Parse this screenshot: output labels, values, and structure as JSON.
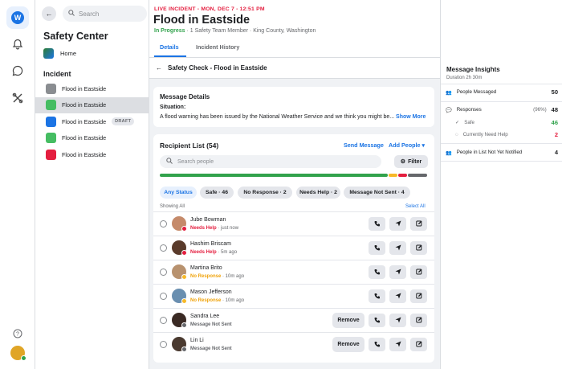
{
  "rail": {
    "logo": "workplace-logo",
    "icons": [
      "bell-icon",
      "chat-icon",
      "tools-icon",
      "help-icon",
      "avatar"
    ]
  },
  "sidebar": {
    "search_placeholder": "Search",
    "title": "Safety Center",
    "home_label": "Home",
    "section": "Incident",
    "items": [
      {
        "label": "Flood in Eastside",
        "color": "#8a8d91",
        "badge": ""
      },
      {
        "label": "Flood in Eastside",
        "color": "#45bd62",
        "badge": ""
      },
      {
        "label": "Flood in Eastside",
        "color": "#1b74e4",
        "badge": "DRAFT"
      },
      {
        "label": "Flood in Eastside",
        "color": "#45bd62",
        "badge": ""
      },
      {
        "label": "Flood in Eastside",
        "color": "#e41e3f",
        "badge": ""
      }
    ]
  },
  "header": {
    "live": "LIVE INCIDENT - MON, DEC 7 - 12:51 PM",
    "title": "Flood in Eastside",
    "status": "In Progress",
    "details": " · 1 Safety Team Member · King County, Washington",
    "tabs": [
      "Details",
      "Incident History"
    ]
  },
  "safety_check": {
    "title": "Safety Check - Flood in Eastside"
  },
  "message": {
    "title": "Message Details",
    "situation_label": "Situation:",
    "text": "A flood warning has been issued by the National Weather Service and we think you might be... ",
    "show_more": "Show More"
  },
  "recipients": {
    "title": "Recipient List (54)",
    "send": "Send Message",
    "add": "Add People",
    "search_placeholder": "Search people",
    "filter": "Filter",
    "progress": {
      "safe": 46,
      "no_response": 2,
      "needs_help": 2,
      "not_sent": 4,
      "colors": [
        "#31a24c",
        "#f7b928",
        "#e41e3f",
        "#65676b"
      ]
    },
    "chips": [
      "Any Status",
      "Safe · 46",
      "No Response · 2",
      "Needs Help · 2",
      "Message Not Sent · 4"
    ],
    "showing": "Showing All",
    "select_all": "Select All",
    "remove": "Remove",
    "rows": [
      {
        "name": "Jube Bowman",
        "status": "Needs Help",
        "time": " · just now",
        "status_color": "#e41e3f",
        "avatar": "#c58a6a",
        "dot": "#e41e3f"
      },
      {
        "name": "Hashim Briscam",
        "status": "Needs Help",
        "time": " · 5m ago",
        "status_color": "#e41e3f",
        "avatar": "#5a3b2b",
        "dot": "#e41e3f"
      },
      {
        "name": "Martina Brito",
        "status": "No Response",
        "time": " · 10m ago",
        "status_color": "#f0a30a",
        "avatar": "#b8926f",
        "dot": "#f7b928"
      },
      {
        "name": "Mason Jefferson",
        "status": "No Response",
        "time": " · 10m ago",
        "status_color": "#f0a30a",
        "avatar": "#6a8fb0",
        "dot": "#f7b928"
      },
      {
        "name": "Sandra Lee",
        "status": "Message Not Sent",
        "time": "",
        "status_color": "#65676b",
        "avatar": "#3a2a24",
        "dot": "#65676b"
      },
      {
        "name": "Lin Li",
        "status": "Message Not Sent",
        "time": "",
        "status_color": "#65676b",
        "avatar": "#4a3a30",
        "dot": "#65676b"
      }
    ]
  },
  "insights": {
    "title": "Message Insights",
    "duration": "Duration 2h 30m",
    "people_messaged": "People Messaged",
    "people_messaged_v": "50",
    "responses": "Responses",
    "responses_pct": "(96%)",
    "responses_v": "48",
    "safe": "Safe",
    "safe_v": "46",
    "need_help": "Currently Need Help",
    "need_help_v": "2",
    "not_notified": "People in List Not Yet Notified",
    "not_notified_v": "4"
  }
}
